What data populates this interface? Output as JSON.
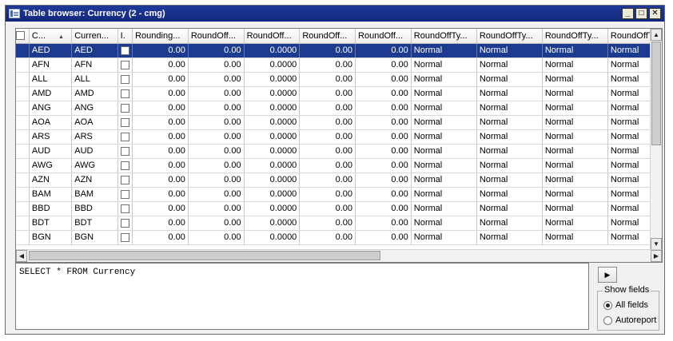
{
  "window": {
    "title": "Table browser: Currency (2 - cmg)",
    "buttons": {
      "minimize": "_",
      "maximize": "□",
      "close": "✕"
    }
  },
  "grid": {
    "columns": [
      "C...",
      "Curren...",
      "I.",
      "Rounding...",
      "RoundOff...",
      "RoundOff...",
      "RoundOff...",
      "RoundOff...",
      "RoundOffTy...",
      "RoundOffTy...",
      "RoundOffTy...",
      "RoundOffTy"
    ],
    "selected_row": 0,
    "rows": [
      [
        "AED",
        "AED",
        "0.00",
        "0.00",
        "0.0000",
        "0.00",
        "0.00",
        "Normal",
        "Normal",
        "Normal",
        "Normal"
      ],
      [
        "AFN",
        "AFN",
        "0.00",
        "0.00",
        "0.0000",
        "0.00",
        "0.00",
        "Normal",
        "Normal",
        "Normal",
        "Normal"
      ],
      [
        "ALL",
        "ALL",
        "0.00",
        "0.00",
        "0.0000",
        "0.00",
        "0.00",
        "Normal",
        "Normal",
        "Normal",
        "Normal"
      ],
      [
        "AMD",
        "AMD",
        "0.00",
        "0.00",
        "0.0000",
        "0.00",
        "0.00",
        "Normal",
        "Normal",
        "Normal",
        "Normal"
      ],
      [
        "ANG",
        "ANG",
        "0.00",
        "0.00",
        "0.0000",
        "0.00",
        "0.00",
        "Normal",
        "Normal",
        "Normal",
        "Normal"
      ],
      [
        "AOA",
        "AOA",
        "0.00",
        "0.00",
        "0.0000",
        "0.00",
        "0.00",
        "Normal",
        "Normal",
        "Normal",
        "Normal"
      ],
      [
        "ARS",
        "ARS",
        "0.00",
        "0.00",
        "0.0000",
        "0.00",
        "0.00",
        "Normal",
        "Normal",
        "Normal",
        "Normal"
      ],
      [
        "AUD",
        "AUD",
        "0.00",
        "0.00",
        "0.0000",
        "0.00",
        "0.00",
        "Normal",
        "Normal",
        "Normal",
        "Normal"
      ],
      [
        "AWG",
        "AWG",
        "0.00",
        "0.00",
        "0.0000",
        "0.00",
        "0.00",
        "Normal",
        "Normal",
        "Normal",
        "Normal"
      ],
      [
        "AZN",
        "AZN",
        "0.00",
        "0.00",
        "0.0000",
        "0.00",
        "0.00",
        "Normal",
        "Normal",
        "Normal",
        "Normal"
      ],
      [
        "BAM",
        "BAM",
        "0.00",
        "0.00",
        "0.0000",
        "0.00",
        "0.00",
        "Normal",
        "Normal",
        "Normal",
        "Normal"
      ],
      [
        "BBD",
        "BBD",
        "0.00",
        "0.00",
        "0.0000",
        "0.00",
        "0.00",
        "Normal",
        "Normal",
        "Normal",
        "Normal"
      ],
      [
        "BDT",
        "BDT",
        "0.00",
        "0.00",
        "0.0000",
        "0.00",
        "0.00",
        "Normal",
        "Normal",
        "Normal",
        "Normal"
      ],
      [
        "BGN",
        "BGN",
        "0.00",
        "0.00",
        "0.0000",
        "0.00",
        "0.00",
        "Normal",
        "Normal",
        "Normal",
        "Normal"
      ]
    ]
  },
  "query": {
    "text": "SELECT * FROM Currency"
  },
  "run_button": {
    "icon": "play-icon",
    "label": "▶"
  },
  "show_fields": {
    "legend": "Show fields",
    "options": [
      "All fields",
      "Autoreport"
    ],
    "selected": "All fields"
  },
  "colors": {
    "title_bar": "#1f3a9a",
    "selected_row": "#1c3b8e"
  }
}
